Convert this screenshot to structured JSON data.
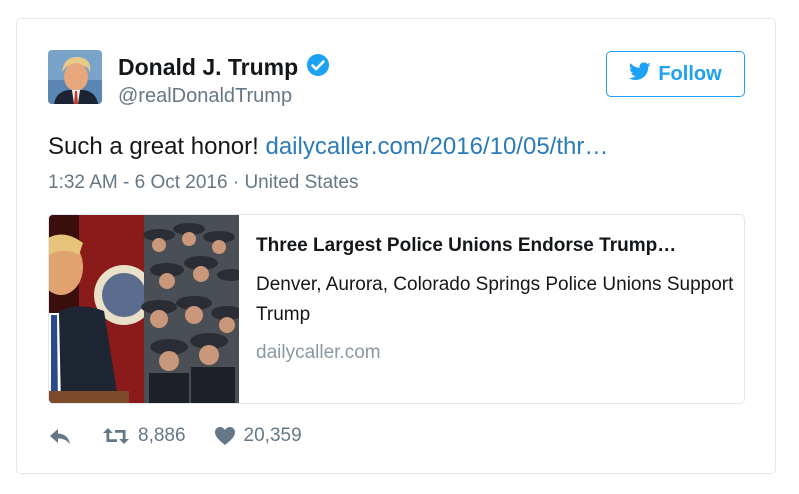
{
  "user": {
    "display_name": "Donald J. Trump",
    "handle": "@realDonaldTrump",
    "verified": true
  },
  "follow_button": {
    "label": "Follow"
  },
  "tweet": {
    "text": "Such a great honor!",
    "link_text": "dailycaller.com/2016/10/05/thr…",
    "timestamp": "1:32 AM - 6 Oct 2016",
    "location": "United States"
  },
  "card": {
    "title": "Three Largest Police Unions Endorse Trump…",
    "description": "Denver, Aurora, Colorado Springs Police Unions Support Trump",
    "domain": "dailycaller.com"
  },
  "actions": {
    "retweet_count": "8,886",
    "like_count": "20,359"
  },
  "colors": {
    "accent": "#1da1f2",
    "link": "#2b7bb9",
    "muted": "#657786"
  },
  "icons": [
    "verified-badge-icon",
    "twitter-bird-icon",
    "reply-icon",
    "retweet-icon",
    "heart-icon"
  ]
}
